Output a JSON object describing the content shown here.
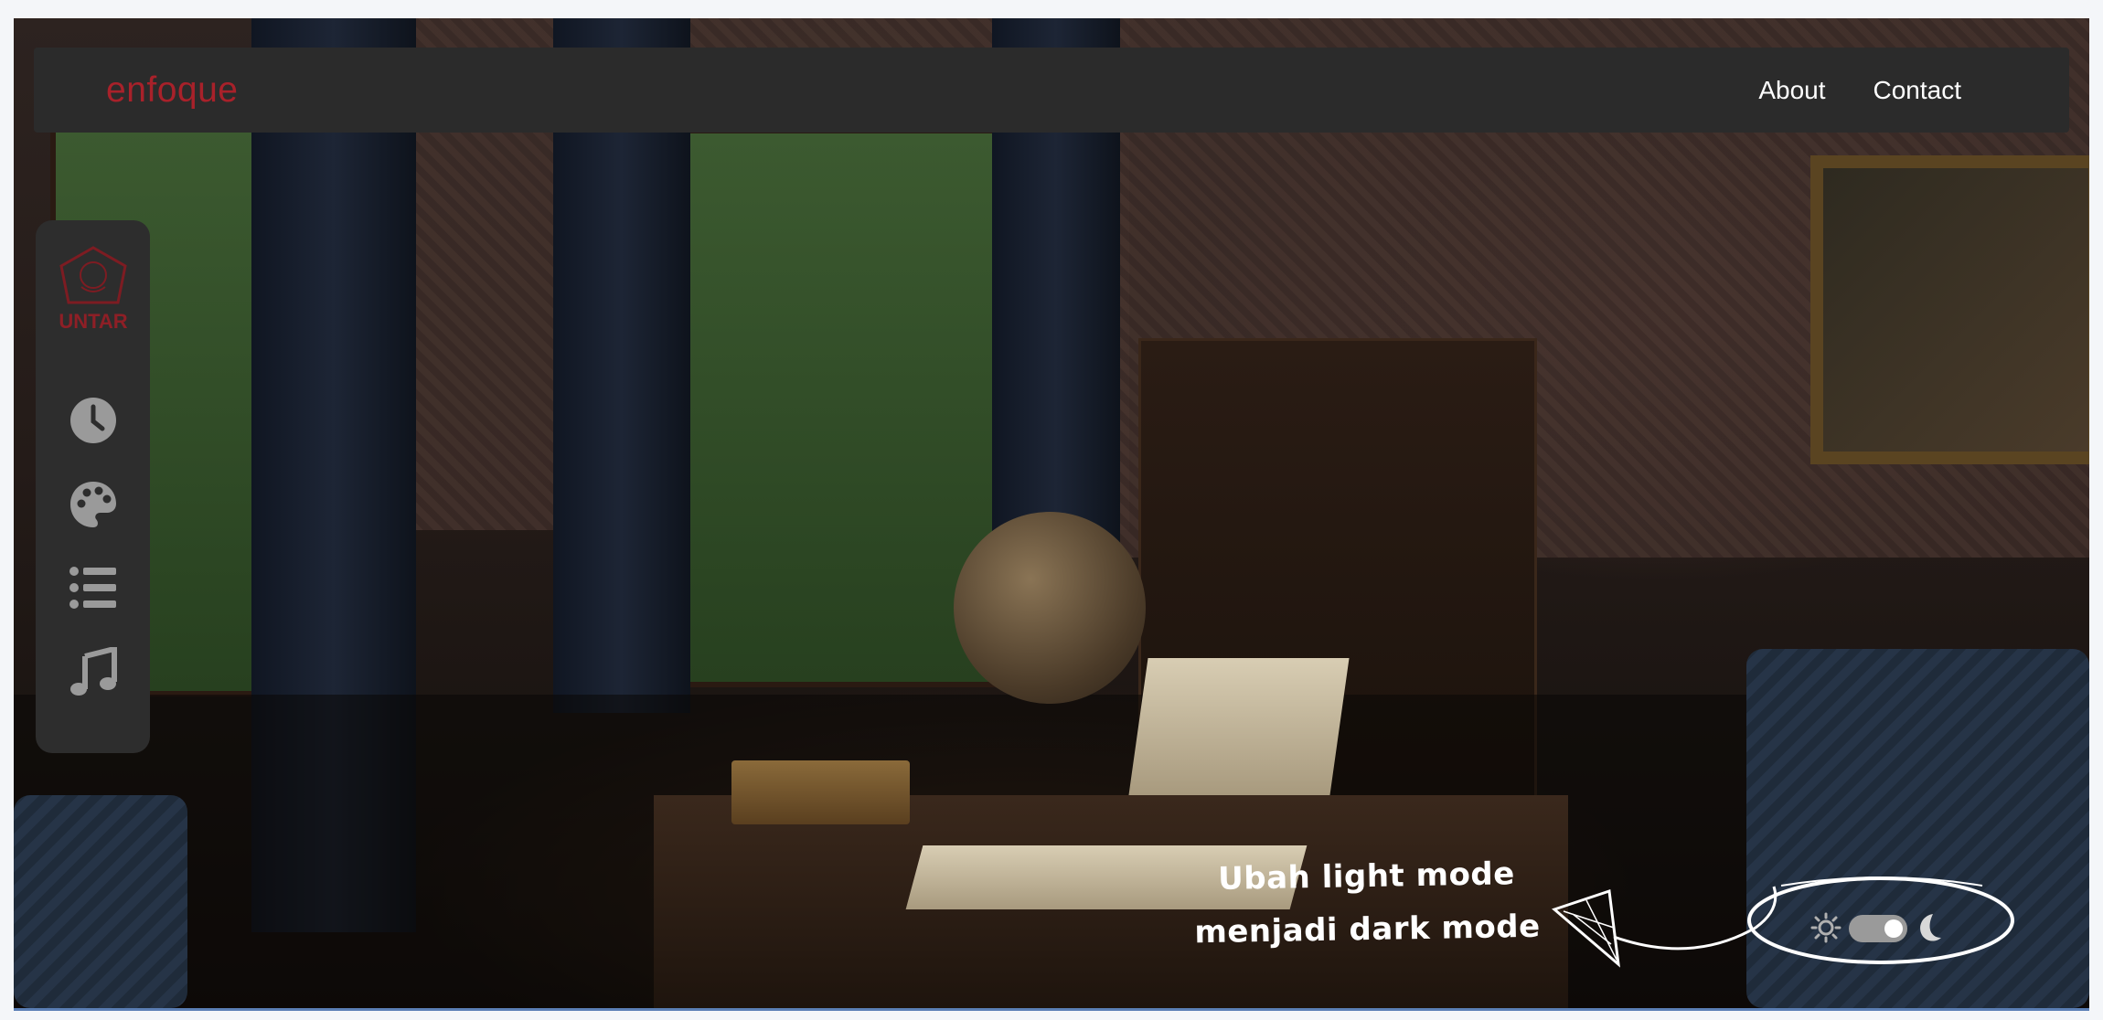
{
  "navbar": {
    "brand": "enfoque",
    "links": [
      {
        "label": "About"
      },
      {
        "label": "Contact"
      }
    ]
  },
  "sidebar": {
    "logo_text": "UNTAR",
    "icons": [
      "clock-icon",
      "palette-icon",
      "list-icon",
      "music-icon"
    ]
  },
  "annotation": {
    "line1": "Ubah light mode",
    "line2": "menjadi dark mode"
  },
  "theme_toggle": {
    "icons": [
      "sun-icon",
      "moon-icon"
    ]
  },
  "colors": {
    "brand": "#a8212a",
    "navbar_bg": "#2b2b2b",
    "sidebar_bg": "#2d2d2d",
    "icon": "#9a9a9a"
  }
}
